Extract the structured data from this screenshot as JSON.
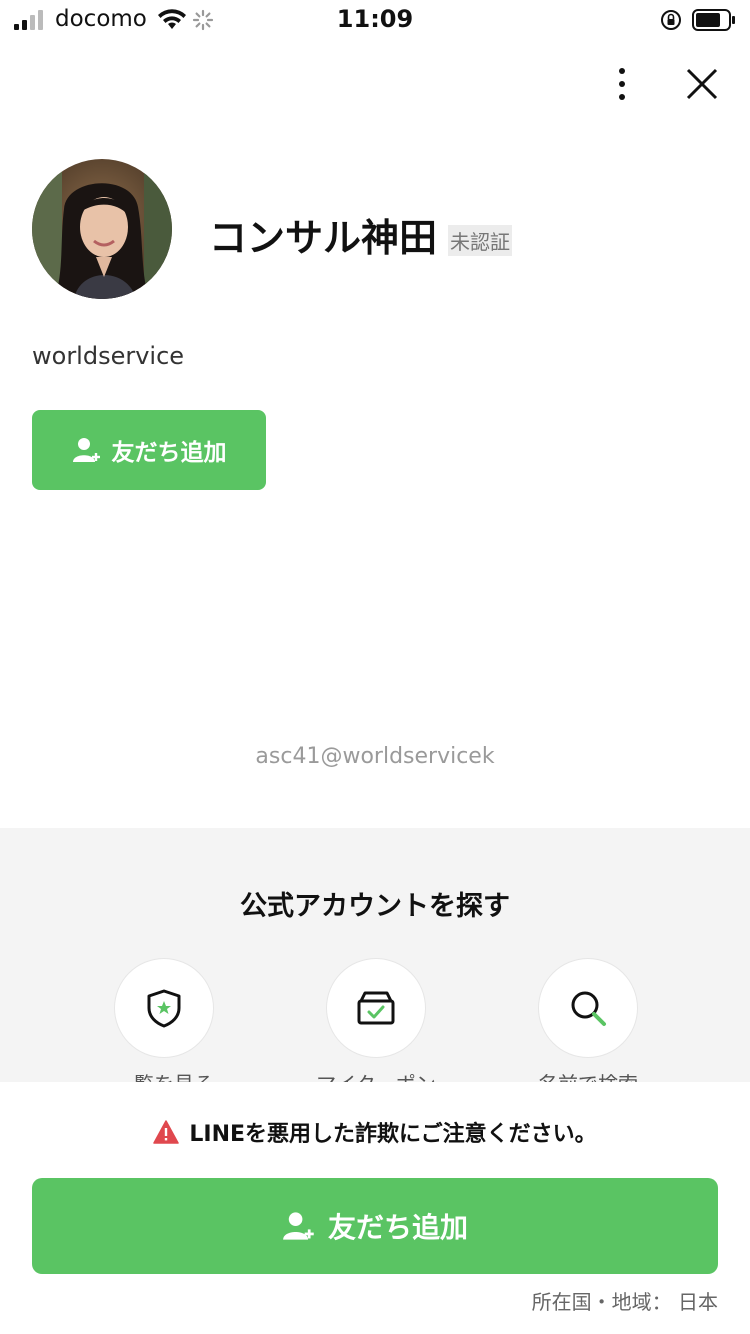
{
  "status_bar": {
    "carrier": "docomo",
    "time": "11:09"
  },
  "profile": {
    "name": "コンサル神田",
    "badge": "未認証",
    "id": "worldservice",
    "add_friend_label": "友だち追加"
  },
  "email_line": "asc41@worldservicek",
  "official": {
    "title": "公式アカウントを探す",
    "items": [
      {
        "label": "一覧を見る",
        "icon": "shield-star-icon"
      },
      {
        "label": "マイクーポン",
        "icon": "coupon-box-icon"
      },
      {
        "label": "名前で検索",
        "icon": "search-icon"
      }
    ]
  },
  "bottom": {
    "warning": "LINEを悪用した詐欺にご注意ください。",
    "add_friend_label": "友だち追加",
    "location": "所在国・地域： 日本"
  },
  "colors": {
    "accent": "#5ac463",
    "warning": "#e0484e",
    "section_bg": "#f4f4f4"
  }
}
